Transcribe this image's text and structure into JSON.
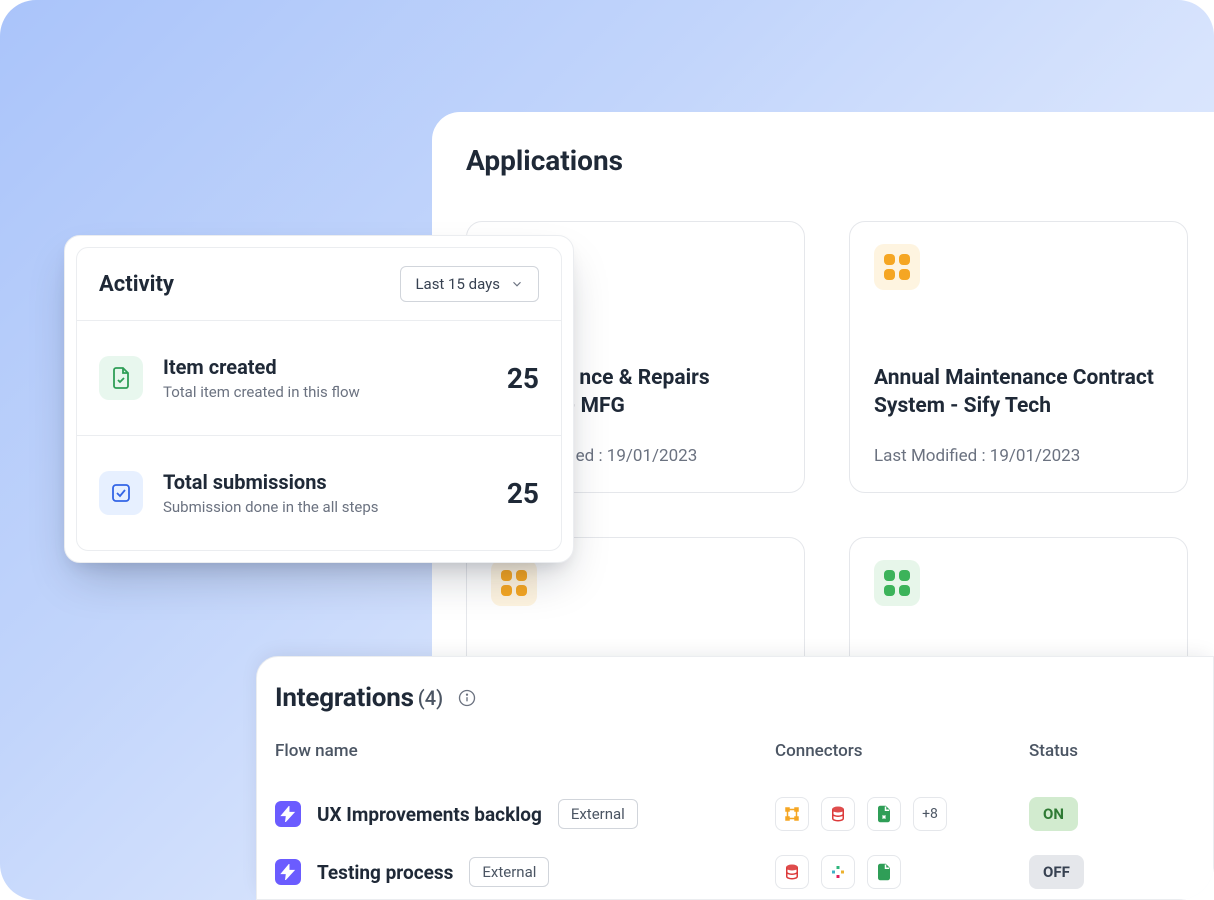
{
  "applications": {
    "title": "Applications",
    "cards": [
      {
        "title_frag_suffix": "nce & Repairs",
        "title_frag_line2_suffix": "- MFG",
        "last_modified_suffix": "ed : 19/01/2023"
      },
      {
        "title": "Annual Maintenance Contract System - Sify Tech",
        "last_modified": "Last Modified : 19/01/2023"
      }
    ]
  },
  "activity": {
    "title": "Activity",
    "range": "Last 15 days",
    "metrics": [
      {
        "title": "Item created",
        "subtitle": "Total item created in this flow",
        "value": "25"
      },
      {
        "title": "Total submissions",
        "subtitle": "Submission done in the all steps",
        "value": "25"
      }
    ]
  },
  "integrations": {
    "title": "Integrations",
    "count": "(4)",
    "columns": {
      "flow": "Flow name",
      "connectors": "Connectors",
      "status": "Status"
    },
    "rows": [
      {
        "name": "UX Improvements backlog",
        "tag": "External",
        "more": "+8",
        "status": "ON"
      },
      {
        "name": "Testing process",
        "tag": "External",
        "status": "OFF"
      }
    ]
  }
}
